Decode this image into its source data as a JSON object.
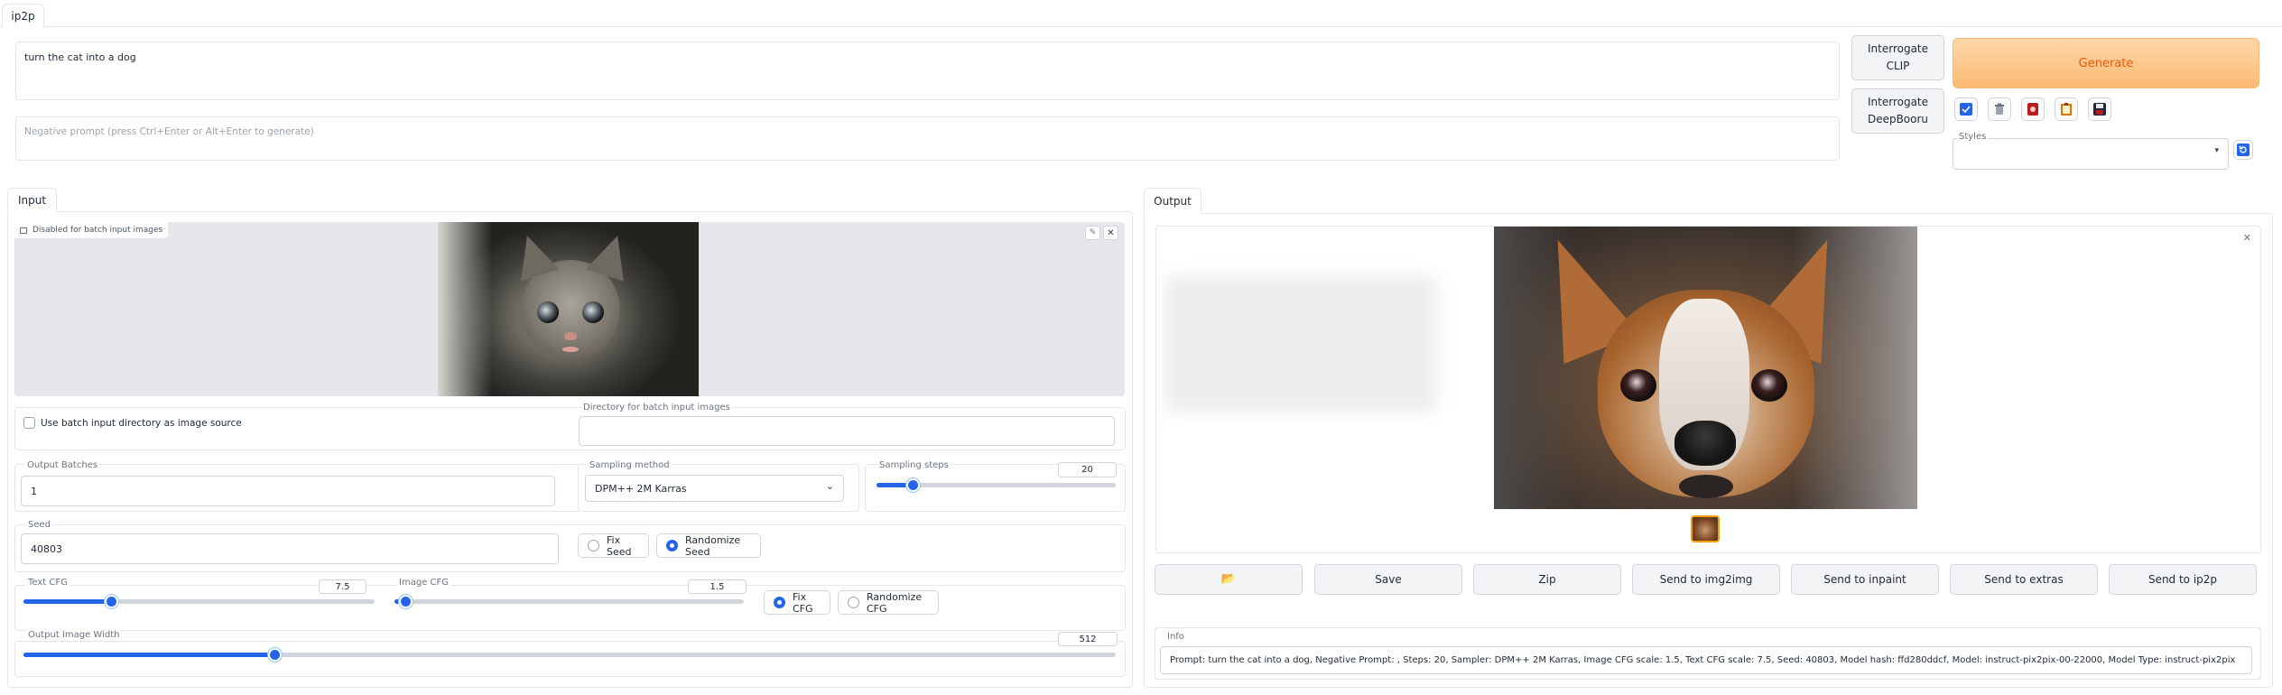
{
  "top_tab": {
    "label": "ip2p"
  },
  "prompt": {
    "value": "turn the cat into a dog"
  },
  "negative_prompt": {
    "placeholder": "Negative prompt (press Ctrl+Enter or Alt+Enter to generate)"
  },
  "interrogate": {
    "clip_line1": "Interrogate",
    "clip_line2": "CLIP",
    "deepbooru_line1": "Interrogate",
    "deepbooru_line2": "DeepBooru"
  },
  "generate": {
    "label": "Generate"
  },
  "styles": {
    "label": "Styles"
  },
  "input_panel": {
    "tab_label": "Input",
    "image_badge": "Disabled for batch input images",
    "batch_checkbox_label": "Use batch input directory as image source",
    "batch_checkbox_checked": false,
    "batch_dir_label": "Directory for batch input images",
    "batch_dir_value": "",
    "output_batches_label": "Output Batches",
    "output_batches_value": "1",
    "sampling_method_label": "Sampling method",
    "sampling_method_value": "DPM++ 2M Karras",
    "sampling_steps_label": "Sampling steps",
    "sampling_steps_value": "20",
    "sampling_steps_fraction": 0.15,
    "seed_label": "Seed",
    "seed_value": "40803",
    "seed_options": [
      "Fix Seed",
      "Randomize Seed"
    ],
    "seed_selected": "Randomize Seed",
    "text_cfg_label": "Text CFG",
    "text_cfg_value": "7.5",
    "text_cfg_fraction": 0.25,
    "image_cfg_label": "Image CFG",
    "image_cfg_value": "1.5",
    "image_cfg_fraction": 0.03,
    "cfg_options": [
      "Fix CFG",
      "Randomize CFG"
    ],
    "cfg_selected": "Fix CFG",
    "width_label": "Output Image Width",
    "width_value": "512",
    "width_fraction": 0.23
  },
  "output_panel": {
    "tab_label": "Output",
    "buttons": {
      "folder_icon": "📂",
      "save": "Save",
      "zip": "Zip",
      "img2img": "Send to img2img",
      "inpaint": "Send to inpaint",
      "extras": "Send to extras",
      "ip2p": "Send to ip2p"
    },
    "info_label": "Info",
    "info_text": "Prompt: turn the cat into a dog, Negative Prompt: , Steps: 20, Sampler: DPM++ 2M Karras, Image CFG scale: 1.5, Text CFG scale: 7.5, Seed: 40803, Model hash: ffd280ddcf, Model: instruct-pix2pix-00-22000, Model Type: instruct-pix2pix"
  },
  "colors": {
    "accent": "#2563eb",
    "generate_bg": "#fdba74",
    "generate_text": "#ea580c"
  }
}
